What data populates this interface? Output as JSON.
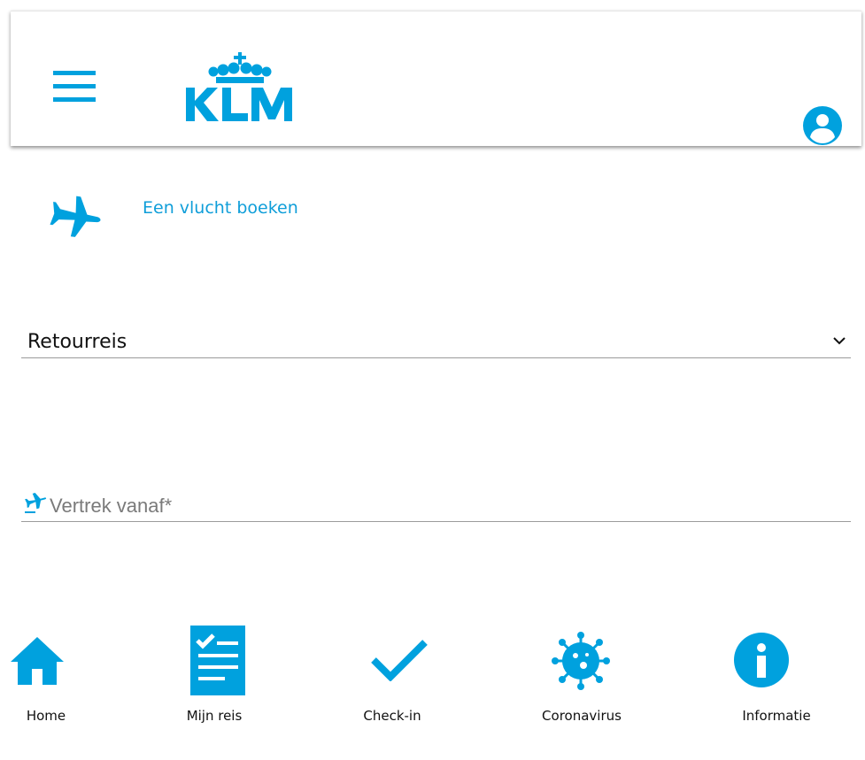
{
  "header": {
    "brand": "KLM",
    "menu_icon": "hamburger-menu-icon",
    "account_icon": "account-circle-icon"
  },
  "booking": {
    "label": "Een vlucht boeken",
    "icon": "airplane-icon"
  },
  "trip_type": {
    "value": "Retourreis",
    "icon": "chevron-down-icon"
  },
  "departure": {
    "placeholder": "Vertrek vanaf*",
    "value": "",
    "icon": "departure-plane-icon"
  },
  "bottom_nav": {
    "items": [
      {
        "label": "Home",
        "icon": "home-icon"
      },
      {
        "label": "Mijn reis",
        "icon": "checklist-icon"
      },
      {
        "label": "Check-in",
        "icon": "checkmark-icon"
      },
      {
        "label": "Coronavirus",
        "icon": "virus-icon"
      },
      {
        "label": "Informatie",
        "icon": "info-icon"
      }
    ]
  },
  "colors": {
    "brand_blue": "#00a1de",
    "link_blue": "#0f9ed9",
    "underline_gray": "#9b9b9b"
  }
}
